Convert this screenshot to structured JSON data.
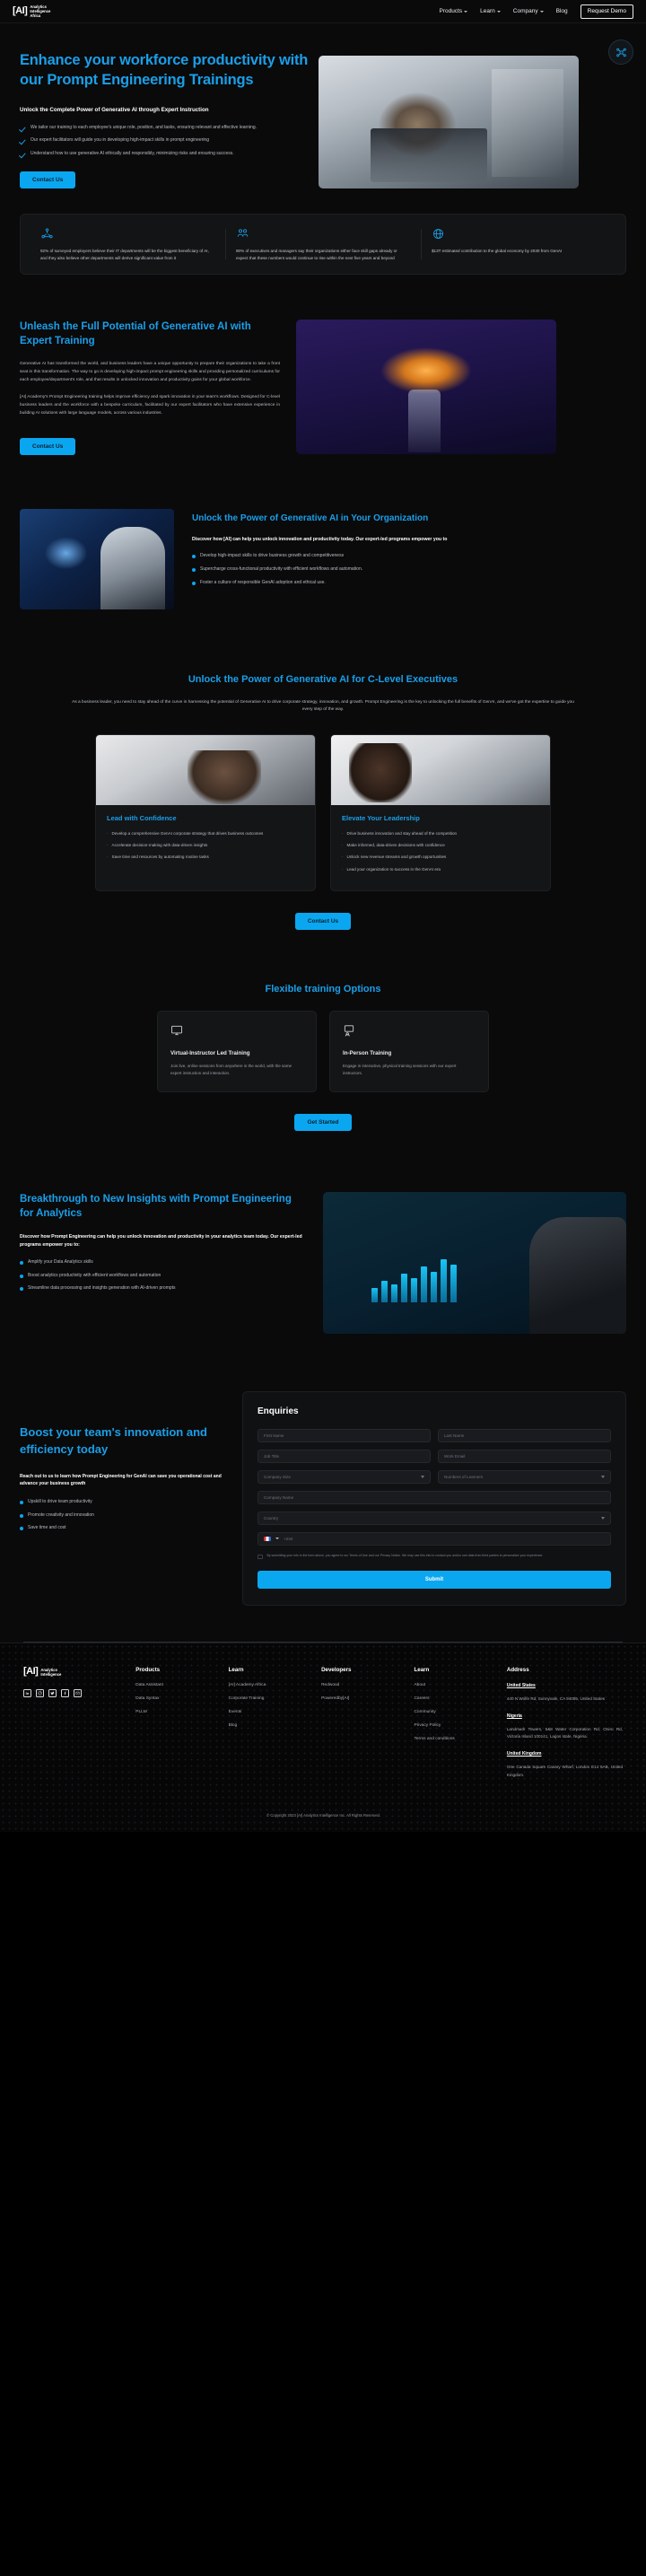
{
  "brand": {
    "mark": "[AI]",
    "name_line1": "Analytics",
    "name_line2": "Intelligence",
    "name_line3": "Africa"
  },
  "header": {
    "nav": [
      {
        "label": "Products",
        "caret": true
      },
      {
        "label": "Learn",
        "caret": true
      },
      {
        "label": "Company",
        "caret": true
      },
      {
        "label": "Blog",
        "caret": false
      }
    ],
    "cta": "Request Demo"
  },
  "hero": {
    "title": "Enhance your workforce productivity with our Prompt Engineering Trainings",
    "subtitle": "Unlock the Complete Power of Generative AI through Expert Instruction",
    "bullets": [
      "We tailor our training to each employee's unique role, position, and tasks, ensuring relevant and effective learning.",
      "Our expert facilitators will guide you in developing high-impact skills in prompt engineering",
      "Understand how to use generative AI ethically and responsibly, minimizing risks and ensuring success."
    ],
    "cta": "Contact Us"
  },
  "stats": [
    {
      "icon": "network-nodes-icon",
      "text": "92% of surveyed employers believe their IT departments will be the biggest beneficiary of AI, and they also believe other departments will derive significant value from it"
    },
    {
      "icon": "people-group-icon",
      "text": "90% of executives and managers say their organizations either face skill gaps already or expect that these numbers would continue to rise within the next five years and beyond"
    },
    {
      "icon": "globe-icon",
      "text": "$13T estimated contribution to the global economy by 2030 from GenAI"
    }
  ],
  "unleash": {
    "title": "Unleash the Full Potential of Generative AI with Expert Training",
    "paragraph1": "Generative AI has transformed the world, and business leaders have a unique opportunity to prepare their organizations to take a front seat in this transformation. The way to go is developing high-impact prompt engineering skills and providing personalized curriculums for each employee/department's role, and that results in unlocked innovation and productivity gains for your global workforce.",
    "paragraph2": "[AI] Academy's Prompt Engineering training helps improve efficiency and spark innovation in your team's workflows. Designed for C-level business leaders and the workforce with a bespoke curriculum, facilitated by our expert facilitators who have extensive experience in building AI solutions with large language models, across various industries.",
    "cta": "Contact Us",
    "image_alt": "glowing-ai-brain-image"
  },
  "unlock": {
    "title": "Unlock the Power of Generative AI in Your Organization",
    "lead": "Discover how [AI] can help you unlock innovation and productivity today. Our expert-led programs empower you to",
    "bullets": [
      "Develop high-impact skills to drive business growth and competitiveness",
      "Supercharge cross-functional productivity with efficient workflows and automation.",
      "Foster a culture of responsible GenAI adoption and ethical use."
    ],
    "image_alt": "ai-screen-presenter-image"
  },
  "clevel": {
    "title": "Unlock the Power of Generative AI for C-Level Executives",
    "intro": "As a business leader, you need to stay ahead of the curve in harnessing the potential of Generative AI to drive corporate strategy, innovation, and growth. Prompt Engineering is the key to unlocking the full benefits of GenAI, and we've got the expertise to guide you every step of the way.",
    "cards": [
      {
        "title": "Lead with Confidence",
        "image_alt": "team-collaboration-image",
        "bullets": [
          "Develop a comprehensive GenAI corporate strategy that drives business outcomes",
          "Accelerate decision-making with data-driven insights",
          "Save time and resources by automating routine tasks"
        ]
      },
      {
        "title": "Elevate Your Leadership",
        "image_alt": "executive-meeting-image",
        "bullets": [
          "Drive business innovation and stay ahead of the competition",
          "Make informed, data-driven decisions with confidence",
          "Unlock new revenue streams and growth opportunities",
          "Lead your organization to success in the GenAI era"
        ]
      }
    ],
    "cta": "Contact Us"
  },
  "flexible": {
    "title": "Flexible training Options",
    "options": [
      {
        "icon": "monitor-icon",
        "title": "Virtual-Instructor Led Training",
        "text": "Join live, online sessions from anywhere in the world, with the same expert instruction and interaction."
      },
      {
        "icon": "presenter-icon",
        "title": "In-Person Training",
        "text": "Engage in interactive, physical training sessions with our expert instructors."
      }
    ],
    "cta": "Get Started"
  },
  "breakthrough": {
    "title": "Breakthrough to New Insights with Prompt Engineering for Analytics",
    "lead": "Discover how Prompt Engineering can help you unlock innovation and productivity in your analytics team today. Our expert-led programs empower you to:",
    "bullets": [
      "Amplify your Data Analytics skills",
      "Boost analytics productivity with efficient workflows and automation",
      "Streamline data processing and insights generation with AI-driven prompts"
    ],
    "image_alt": "analytics-dashboard-touchscreen-image"
  },
  "form": {
    "left_title": "Boost your team's innovation and efficiency today",
    "left_lead": "Reach out to us to learn how Prompt Engineering for GenAI can save you operational cost and advance your business growth",
    "left_bullets": [
      "Upskill to drive team productivity",
      "Promote creativity and innovation",
      "Save time and cost"
    ],
    "title": "Enquiries",
    "fields": {
      "first_name": "First Name",
      "last_name": "Last Name",
      "job_title": "Job Title",
      "work_email": "Work Email",
      "company_size": "Company Size",
      "number_of_learners": "Numbers of Learners",
      "company_name": "Company Name",
      "country": "Country",
      "phone": "+234",
      "phone_placeholder": "+234"
    },
    "consent": "By submitting your info in the form above, you agree to our Terms of Use and our Privacy Notice. We may use this info to contact you and/or use data from third parties to personalize your experience.",
    "consent_link1": "Terms of Use",
    "consent_link2": "Privacy Notice",
    "submit": "Submit"
  },
  "footer": {
    "socials": [
      "linkedin-icon",
      "instagram-icon",
      "twitter-icon",
      "facebook-icon",
      "email-icon"
    ],
    "columns": [
      {
        "head": "Products",
        "links": [
          "Data Assistant",
          "Data Syntax",
          "PLLM"
        ]
      },
      {
        "head": "Learn",
        "links": [
          "[AI] Academy Africa",
          "Corporate Training",
          "Events",
          "Blog"
        ]
      },
      {
        "head": "Developers",
        "links": [
          "Redwood",
          "Poweredby[AI]"
        ]
      },
      {
        "head": "Learn",
        "links": [
          "About",
          "Careers",
          "Community",
          "Privacy Policy",
          "Terms and conditions"
        ]
      }
    ],
    "address_head": "Address",
    "addresses": [
      {
        "country": "United States",
        "text": "440 N Wolfe Rd, Sunnyvale, CA 94085, United States"
      },
      {
        "country": "Nigeria",
        "text": "Landmark Towers, 5&8 Water Corporation Rd, Oniru Rd, Victoria Island 100141, Lagos state, Nigeria."
      },
      {
        "country": "United Kingdom",
        "text": "One Canada Square Canary Wharf, London E14 5AB, United Kingdom."
      }
    ],
    "copyright": "© Copyright 2023 [AI] Analytics Intelligence Inc. All Rights Reserved"
  },
  "colors": {
    "accent": "#1a9fe8",
    "button": "#0aa7f0",
    "background": "#0a0a0b"
  }
}
